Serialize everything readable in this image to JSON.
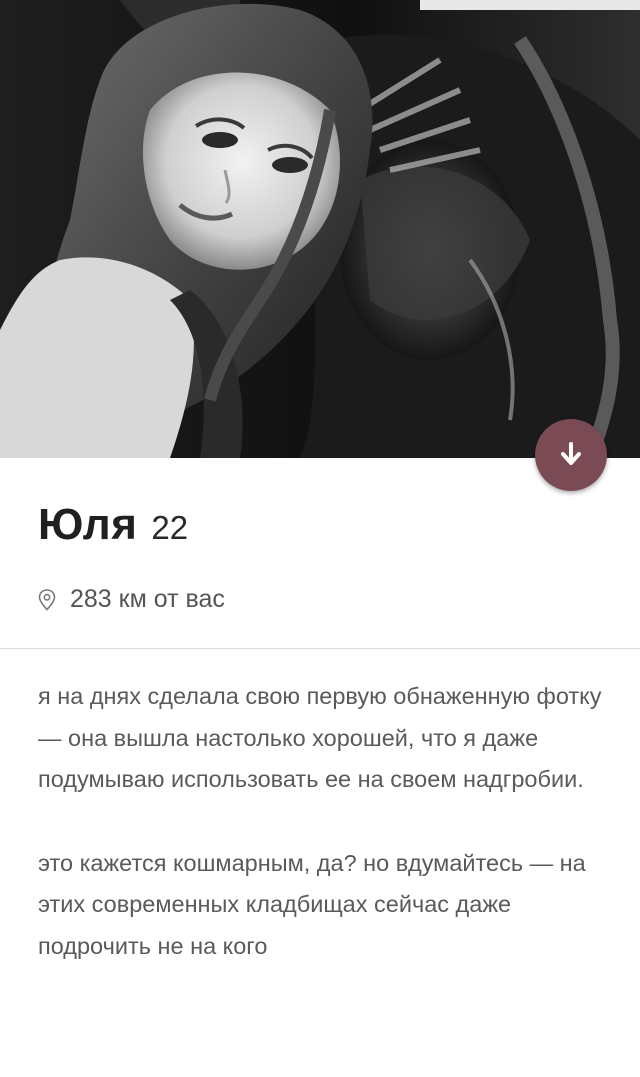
{
  "profile": {
    "name": "Юля",
    "age": "22",
    "distance": "283 км от вас"
  },
  "bio": {
    "paragraph1": "я на днях сделала свою первую обнаженную фотку — она вышла настолько хорошей, что я даже подумываю использовать ее на своем надгробии.",
    "paragraph2": "это кажется кошмарным, да? но вдумайтесь — на этих современных кладбищах сейчас даже подрочить не на кого"
  },
  "icons": {
    "collapse": "arrow-down-icon",
    "location": "location-pin-icon"
  },
  "colors": {
    "collapse_button": "#7a4a55",
    "name_text": "#202020",
    "bio_text": "#5a5a5a"
  }
}
